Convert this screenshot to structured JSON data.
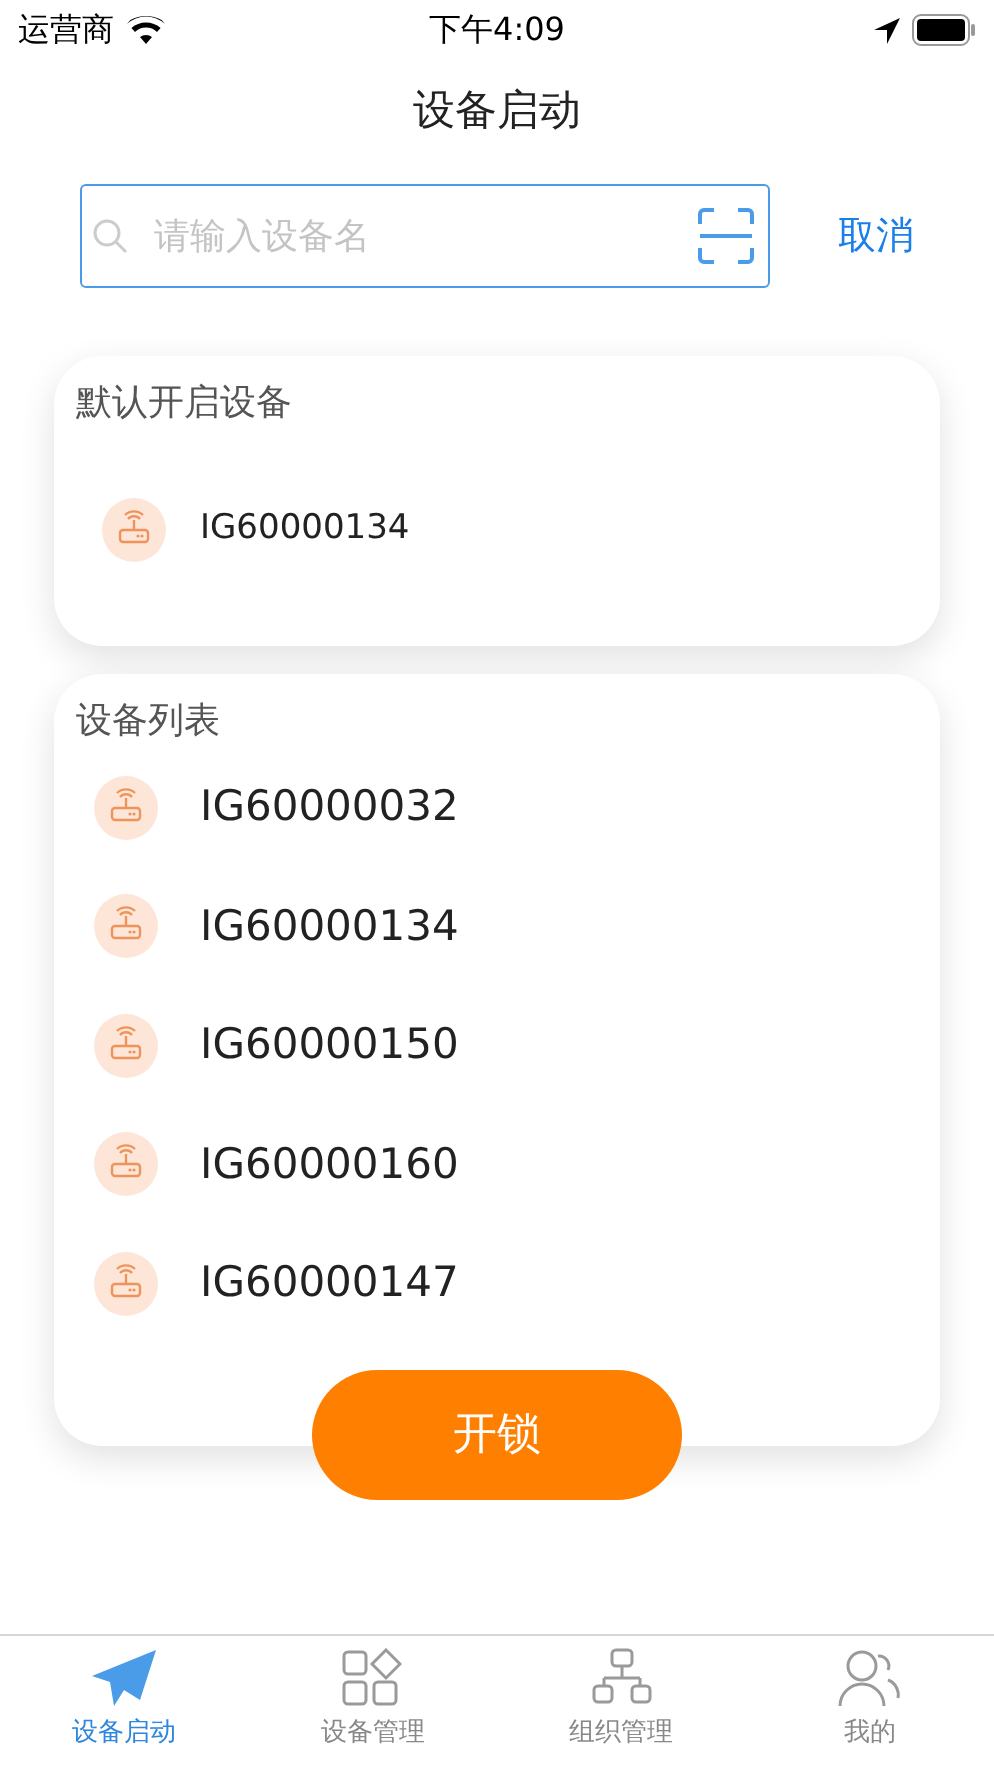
{
  "status_bar": {
    "carrier": "运营商",
    "time": "下午4:09"
  },
  "title": "设备启动",
  "search": {
    "placeholder": "请输入设备名",
    "cancel": "取消"
  },
  "default_section": {
    "title": "默认开启设备",
    "devices": [
      "IG60000134"
    ]
  },
  "list_section": {
    "title": "设备列表",
    "devices": [
      "IG60000032",
      "IG60000134",
      "IG60000150",
      "IG60000160",
      "IG60000147"
    ]
  },
  "unlock_button": "开锁",
  "tabs": [
    {
      "label": "设备启动",
      "kind": "send",
      "selected": true
    },
    {
      "label": "设备管理",
      "kind": "apps",
      "selected": false
    },
    {
      "label": "组织管理",
      "kind": "org",
      "selected": false
    },
    {
      "label": "我的",
      "kind": "users",
      "selected": false
    }
  ]
}
